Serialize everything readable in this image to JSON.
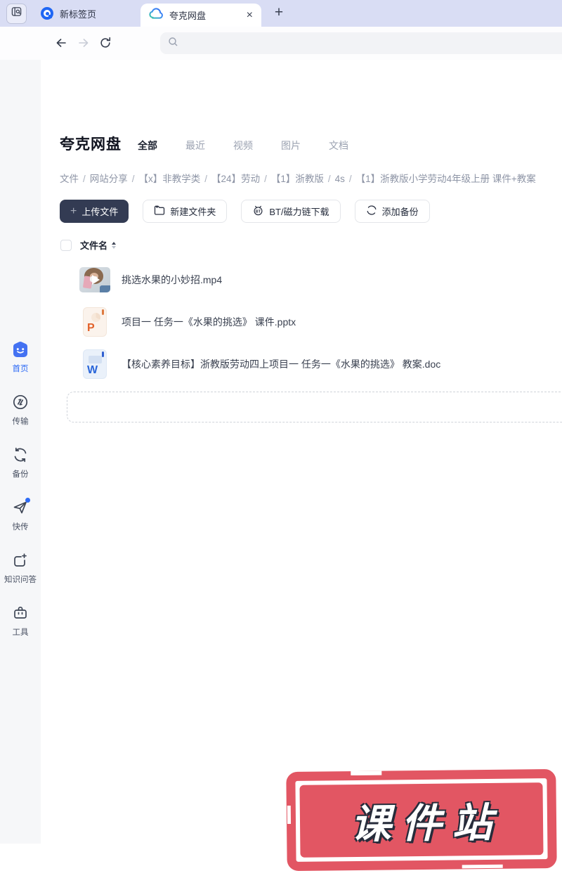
{
  "icons": {
    "plus": "+",
    "close": "×",
    "new_tab": "+"
  },
  "browser": {
    "tabs": [
      {
        "label": "新标签页"
      },
      {
        "label": "夸克网盘"
      }
    ]
  },
  "app": {
    "title": "夸克网盘",
    "nav_tabs": [
      {
        "label": "全部"
      },
      {
        "label": "最近"
      },
      {
        "label": "视频"
      },
      {
        "label": "图片"
      },
      {
        "label": "文档"
      }
    ],
    "breadcrumb_sep": "/",
    "breadcrumb": [
      "文件",
      "网站分享",
      "【x】非教学类",
      "【24】劳动",
      "【1】浙教版",
      "4s",
      "【1】浙教版小学劳动4年级上册 课件+教案"
    ],
    "actions": {
      "upload": "上传文件",
      "new_folder": "新建文件夹",
      "bt": "BT/磁力链下载",
      "backup": "添加备份"
    },
    "table_header": "文件名",
    "files": [
      {
        "name": "挑选水果的小妙招.mp4",
        "type": "video"
      },
      {
        "name": "项目一 任务一《水果的挑选》 课件.pptx",
        "type": "pptx",
        "letter": "P"
      },
      {
        "name": "【核心素养目标】浙教版劳动四上项目一 任务一《水果的挑选》 教案.doc",
        "type": "doc",
        "letter": "W"
      }
    ]
  },
  "sidebar": {
    "items": [
      {
        "label": "首页"
      },
      {
        "label": "传输"
      },
      {
        "label": "备份"
      },
      {
        "label": "快传"
      },
      {
        "label": "知识问答"
      },
      {
        "label": "工具"
      }
    ]
  },
  "watermark": {
    "text": "课件站"
  },
  "colors": {
    "accent_blue": "#2e6bf6",
    "stamp_red": "#e25663",
    "primary_button": "#333b53",
    "tabbar_bg": "#d9ddf4"
  }
}
